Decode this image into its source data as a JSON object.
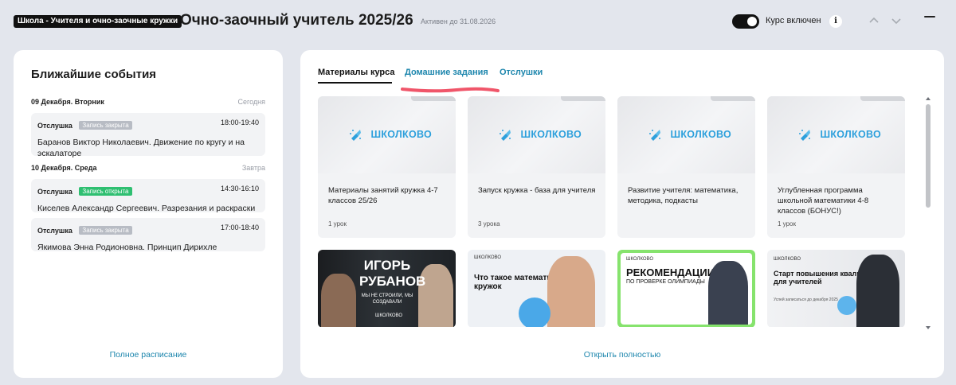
{
  "header": {
    "badge": "Школа - Учителя и очно-заочные кружки",
    "title": "Очно-заочный учитель 2025/26",
    "active_until": "Активен до 31.08.2026",
    "toggle_label": "Курс включен",
    "toggle_on": true,
    "info_label": "i"
  },
  "events": {
    "title": "Ближайшие события",
    "days": [
      {
        "date": "09 Декабря. Вторник",
        "relative": "Сегодня",
        "items": [
          {
            "type": "Отслушка",
            "tag": "Запись закрыта",
            "tag_status": "closed",
            "time": "18:00-19:40",
            "description": "Баранов Виктор Николаевич. Движение по кругу и на эскалаторе"
          }
        ]
      },
      {
        "date": "10 Декабря. Среда",
        "relative": "Завтра",
        "items": [
          {
            "type": "Отслушка",
            "tag": "Запись открыта",
            "tag_status": "open",
            "time": "14:30-16:10",
            "description": "Киселев Александр Сергеевич. Разрезания и раскраски"
          },
          {
            "type": "Отслушка",
            "tag": "Запись закрыта",
            "tag_status": "closed",
            "time": "17:00-18:40",
            "description": "Якимова Энна Родионовна. Принцип Дирихле"
          }
        ]
      }
    ],
    "full_schedule_label": "Полное расписание"
  },
  "tabs": [
    {
      "label": "Материалы курса",
      "active": true
    },
    {
      "label": "Домашние задания",
      "active": false
    },
    {
      "label": "Отслушки",
      "active": false
    }
  ],
  "logo_text": "ШКОЛКОВО",
  "courses": [
    {
      "title": "Материалы занятий кружка 4-7 классов 25/26",
      "lessons": "1 урок"
    },
    {
      "title": "Запуск кружка - база для учителя",
      "lessons": "3 урока"
    },
    {
      "title": "Развитие учителя: математика, методика, подкасты",
      "lessons": ""
    },
    {
      "title": "Углубленная программа школьной математики 4-8 классов (БОНУС!)",
      "lessons": "1 урок"
    }
  ],
  "promos": [
    {
      "big": "ИГОРЬ РУБАНОВ",
      "sub": "МЫ НЕ СТРОИЛИ, МЫ СОЗДАВАЛИ",
      "brand": "ШКОЛКОВО"
    },
    {
      "brand": "ШКОЛКОВО",
      "text": "Что такое математический кружок"
    },
    {
      "brand": "ШКОЛКОВО",
      "big": "РЕКОМЕНДАЦИИ",
      "sub": "ПО ПРОВЕРКЕ ОЛИМПИАДЫ"
    },
    {
      "brand": "ШКОЛКОВО",
      "text": "Старт повышения квалификации для учителей",
      "sub": "Успей записаться до декабря 2025"
    }
  ],
  "open_full_label": "Открыть полностью",
  "colors": {
    "accent": "#1d86ad",
    "logo": "#2da0dc",
    "tag_open": "#2fbf71",
    "tag_closed": "#b8bcc4",
    "highlight": "#f0566a"
  }
}
